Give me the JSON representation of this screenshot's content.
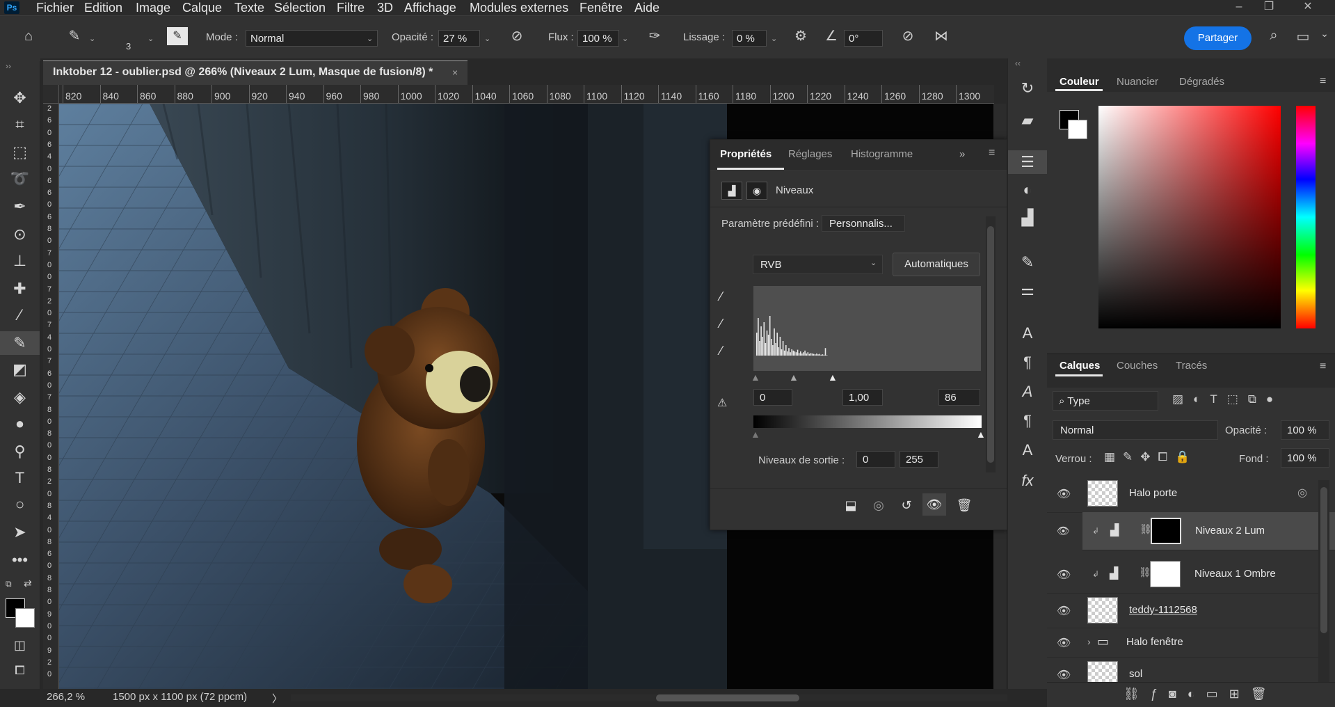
{
  "app": {
    "logo": "Ps"
  },
  "menubar": {
    "items": [
      "Fichier",
      "Edition",
      "Image",
      "Calque",
      "Texte",
      "Sélection",
      "Filtre",
      "3D",
      "Affichage",
      "Modules externes",
      "Fenêtre",
      "Aide"
    ],
    "window_buttons": [
      "–",
      "❐",
      "✕"
    ]
  },
  "options": {
    "brush_size": "3",
    "mode_label": "Mode :",
    "mode_value": "Normal",
    "opacity_label": "Opacité :",
    "opacity_value": "27 %",
    "flow_label": "Flux :",
    "flow_value": "100 %",
    "smoothing_label": "Lissage :",
    "smoothing_value": "0 %",
    "angle_value": "0°",
    "share_label": "Partager"
  },
  "document": {
    "tab_title": "Inktober 12 - oublier.psd @ 266% (Niveaux 2 Lum, Masque de fusion/8) *",
    "close": "×"
  },
  "ruler": {
    "top_ticks": [
      "820",
      "840",
      "860",
      "880",
      "900",
      "920",
      "940",
      "960",
      "980",
      "1000",
      "1020",
      "1040",
      "1060",
      "1080",
      "1100",
      "1120",
      "1140",
      "1160",
      "1180",
      "1200",
      "1220",
      "1240",
      "1260",
      "1280",
      "1300"
    ],
    "left_ticks": [
      "2",
      "6",
      "0",
      "6",
      "4",
      "0",
      "6",
      "6",
      "0",
      "6",
      "8",
      "0",
      "7",
      "0",
      "0",
      "7",
      "2",
      "0",
      "7",
      "4",
      "0",
      "7",
      "6",
      "0",
      "7",
      "8",
      "0",
      "8",
      "0",
      "0",
      "8",
      "2",
      "0",
      "8",
      "4",
      "0",
      "8",
      "6",
      "0",
      "8",
      "8",
      "0",
      "9",
      "0",
      "0",
      "9",
      "2",
      "0"
    ]
  },
  "statusbar": {
    "zoom": "266,2 %",
    "doc_info": "1500 px x 1100 px (72 ppcm)",
    "arrow": "〉"
  },
  "properties": {
    "tabs": [
      "Propriétés",
      "Réglages",
      "Histogramme"
    ],
    "active_tab": "Propriétés",
    "layer_type": "Niveaux",
    "preset_label": "Paramètre prédéfini :",
    "preset_value": "Personnalis...",
    "channel_value": "RVB",
    "auto_button": "Automatiques",
    "input_black": "0",
    "input_gamma": "1,00",
    "input_white": "86",
    "output_label": "Niveaux de sortie :",
    "output_black": "0",
    "output_white": "255",
    "histogram_values": [
      0.55,
      0.9,
      0.35,
      0.7,
      0.45,
      0.8,
      0.3,
      0.6,
      0.5,
      0.95,
      0.4,
      0.25,
      0.65,
      0.3,
      0.55,
      0.2,
      0.45,
      0.15,
      0.35,
      0.12,
      0.25,
      0.1,
      0.18,
      0.08,
      0.15,
      0.12,
      0.1,
      0.08,
      0.14,
      0.06,
      0.1,
      0.05,
      0.08,
      0.12,
      0.05,
      0.08,
      0.04,
      0.06,
      0.05,
      0.04,
      0.03,
      0.05,
      0.03,
      0.04,
      0.02,
      0.03,
      0.02,
      0.18,
      0.01,
      0.0
    ]
  },
  "color_panel": {
    "tabs": [
      "Couleur",
      "Nuancier",
      "Dégradés"
    ],
    "active_tab": "Couleur",
    "foreground": "#000000",
    "background": "#ffffff"
  },
  "layers_panel": {
    "tabs": [
      "Calques",
      "Couches",
      "Tracés"
    ],
    "active_tab": "Calques",
    "filter_value": "Type",
    "blend_mode": "Normal",
    "opacity_label": "Opacité :",
    "opacity_value": "100 %",
    "lock_label": "Verrou :",
    "fill_label": "Fond :",
    "fill_value": "100 %",
    "layers": [
      {
        "name": "Halo porte",
        "kind": "smart",
        "selected": false
      },
      {
        "name": "Niveaux 2 Lum",
        "kind": "adjustment-black-mask",
        "selected": true
      },
      {
        "name": "Niveaux 1 Ombre",
        "kind": "adjustment-white-mask",
        "selected": false
      },
      {
        "name": "teddy-1112568",
        "kind": "smart",
        "selected": false
      },
      {
        "name": "Halo fenêtre",
        "kind": "group",
        "selected": false
      },
      {
        "name": "sol",
        "kind": "pixel",
        "selected": false
      }
    ]
  },
  "colors": {
    "accent": "#1473e6",
    "panel": "#323232",
    "background": "#282828"
  }
}
